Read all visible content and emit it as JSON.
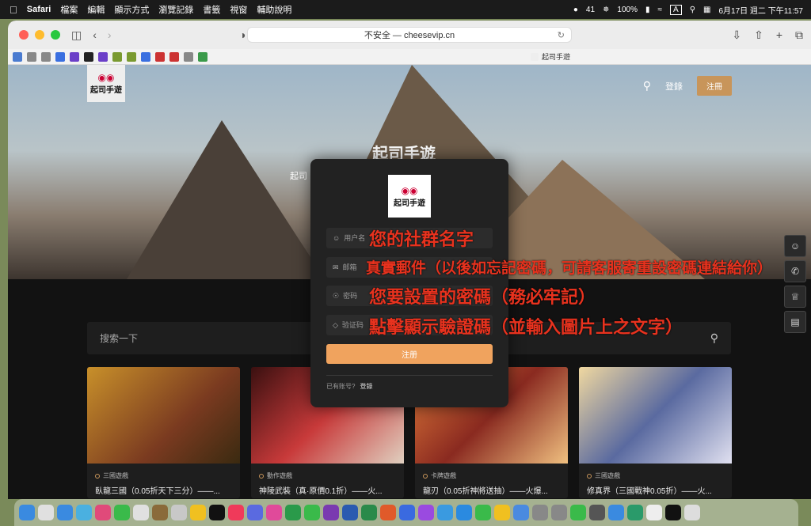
{
  "menubar": {
    "apple": "",
    "app": "Safari",
    "items": [
      "檔案",
      "編輯",
      "顯示方式",
      "瀏覽記錄",
      "書籤",
      "視窗",
      "輔助說明"
    ],
    "wechat_count": "41",
    "battery": "100%",
    "input_method": "A",
    "datetime": "6月17日 週二 下午11:57"
  },
  "browser": {
    "address": "不安全 — cheesevip.cn",
    "tab_title": "起司手遊",
    "bookmark_colors": [
      "#4a7bd0",
      "#888",
      "#888",
      "#3a6fe0",
      "#6b3fc8",
      "#222",
      "#6b3fc8",
      "#7a9a30",
      "#7a9a30",
      "#3a6fe0",
      "#c33",
      "#c33",
      "#888",
      "#3a9a4a"
    ]
  },
  "site": {
    "logo_text": "起司手遊",
    "nav_login": "登錄",
    "nav_register": "注冊",
    "hero_title": "起司手遊",
    "hero_sub": "起司",
    "search_placeholder": "搜索一下"
  },
  "modal": {
    "logo_text": "起司手遊",
    "username_placeholder": "用户名",
    "email_placeholder": "邮箱",
    "password_placeholder": "密码",
    "captcha_placeholder": "验证码",
    "submit_label": "注册",
    "has_account": "已有账号?",
    "login_link": "登錄"
  },
  "annotations": {
    "username": "您的社群名字",
    "email": "真實郵件（以後如忘記密碼，可請客服寄重設密碼連結給你）",
    "password": "您要設置的密碼（務必牢記）",
    "captcha": "點擊顯示驗證碼（並輸入圖片上之文字）"
  },
  "cards": [
    {
      "category": "三國遊戲",
      "title": "臥龍三國（0.05折天下三分）——...",
      "color": "#7a5a20"
    },
    {
      "category": "動作遊戲",
      "title": "神陵武裝（真·原價0.1折）——火...",
      "color": "#6a2020"
    },
    {
      "category": "卡牌遊戲",
      "title": "龍刃（0.05折神將送抽）——火爆...",
      "color": "#8a3020"
    },
    {
      "category": "三國遊戲",
      "title": "修真界（三國戰神0.05折）——火...",
      "color": "#5a6a8a"
    }
  ],
  "dock_colors": [
    "#3a8ae0",
    "#e0e0e0",
    "#3a8ae0",
    "#4ab0e0",
    "#e04a7a",
    "#3aba4a",
    "#e0e0e0",
    "#8a6a3a",
    "#c8c8c8",
    "#f0c020",
    "#111",
    "#f03a5a",
    "#5a6ae0",
    "#e04a9a",
    "#2a9a4a",
    "#3aba4a",
    "#7a3ab0",
    "#2a5ab0",
    "#2a8a4a",
    "#e05a2a",
    "#3a6ae0",
    "#9a4ae0",
    "#3a9ae0",
    "#2a8ae0",
    "#3aba4a",
    "#f0c020",
    "#4a8ae0",
    "#888",
    "#888",
    "#3aba4a",
    "#555",
    "#3a8ae0",
    "#2a9a6a",
    "#eee",
    "#111",
    "#ddd"
  ]
}
